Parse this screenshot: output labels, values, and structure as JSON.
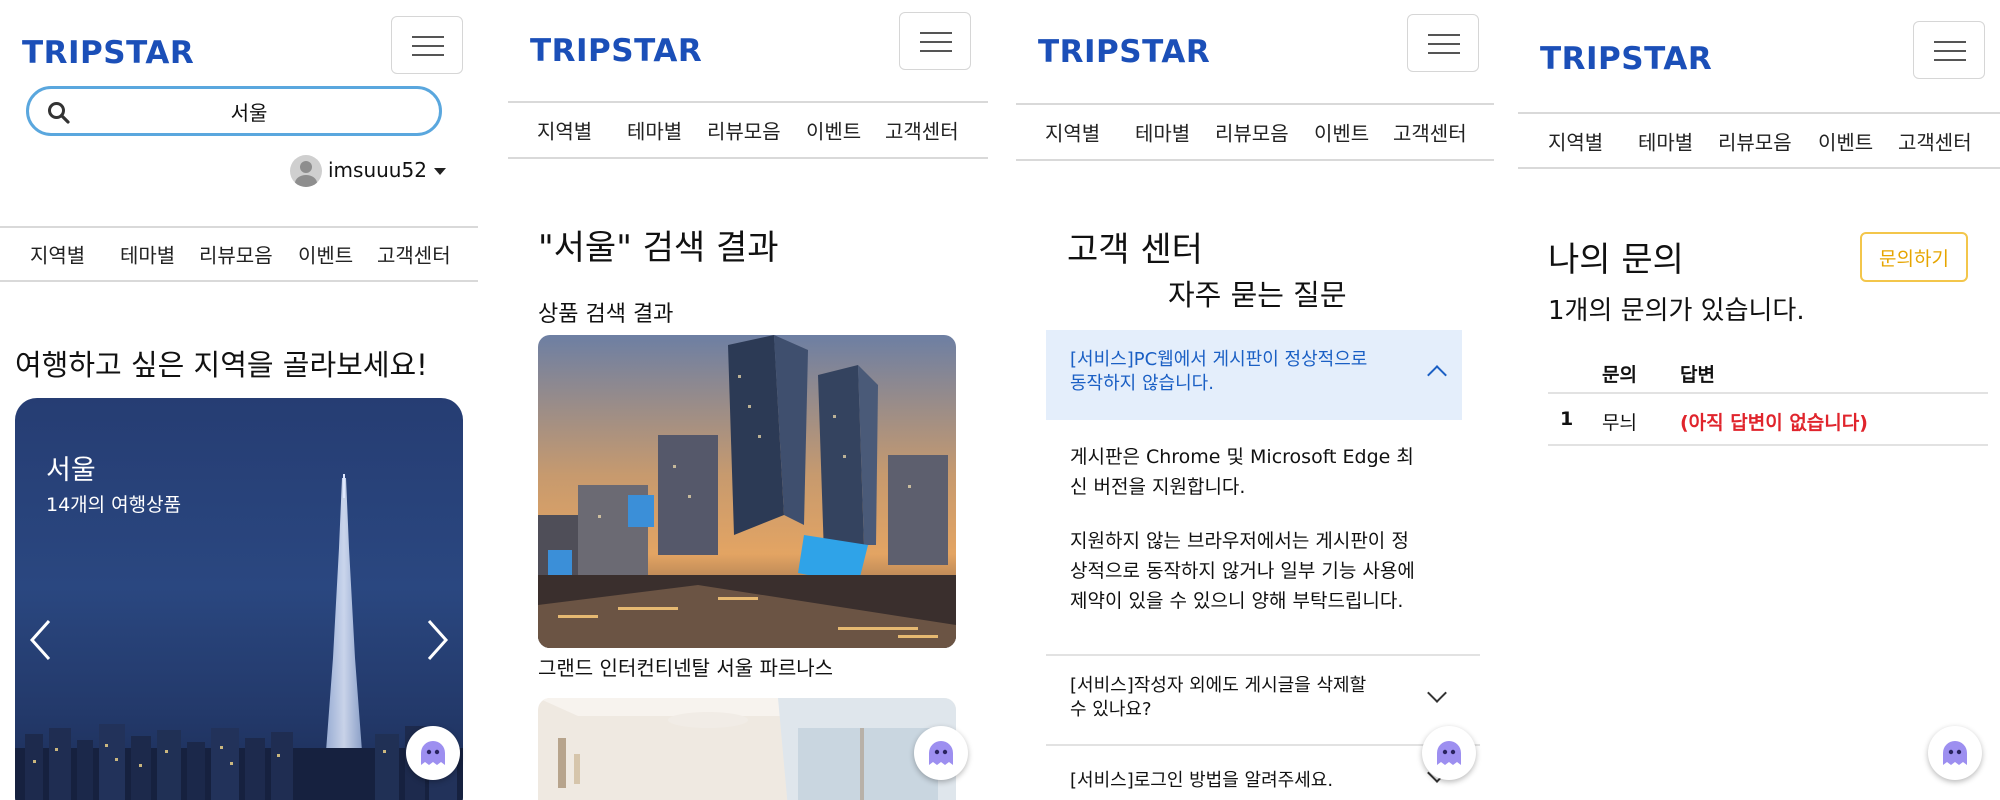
{
  "brand": {
    "logo_text": "TRIPSTAR",
    "color": "#1b4fb8"
  },
  "nav": {
    "items": [
      "지역별",
      "테마별",
      "리뷰모음",
      "이벤트",
      "고객센터"
    ]
  },
  "screen1": {
    "search": {
      "value": "서울"
    },
    "user": {
      "name": "imsuuu52"
    },
    "heading": "여행하고 싶은 지역을 골라보세요!",
    "hero": {
      "title": "서울",
      "subtitle": "14개의 여행상품"
    }
  },
  "screen2": {
    "heading": "\"서울\" 검색 결과",
    "section_title": "상품 검색 결과",
    "results": [
      {
        "name": "그랜드 인터컨티넨탈 서울 파르나스"
      }
    ]
  },
  "screen3": {
    "heading": "고객 센터",
    "faq_title": "자주 묻는 질문",
    "open_question_line1": "[서비스]PC웹에서 게시판이 정상적으로",
    "open_question_line2": "동작하지 않습니다.",
    "answer_p1_line1": "게시판은 Chrome 및 Microsoft Edge 최",
    "answer_p1_line2": "신 버전을 지원합니다.",
    "answer_p2_line1": "지원하지 않는 브라우저에서는 게시판이 정",
    "answer_p2_line2": "상적으로 동작하지 않거나 일부 기능 사용에",
    "answer_p2_line3": "제약이 있을 수 있으니 양해 부탁드립니다.",
    "q2_line1": "[서비스]작성자 외에도 게시글을 삭제할",
    "q2_line2": "수 있나요?",
    "q3_line1": "[서비스]로그인 방법을 알려주세요."
  },
  "screen4": {
    "heading": "나의 문의",
    "inquire_button": "문의하기",
    "count_text": "1개의 문의가 있습니다.",
    "table": {
      "headers": [
        "문의",
        "답변"
      ],
      "rows": [
        {
          "num": "1",
          "inquiry": "무늬",
          "answer": "(아직 답변이 없습니다)"
        }
      ]
    }
  },
  "colors": {
    "accent_blue": "#1b4fb8",
    "search_border": "#5aa7de",
    "faq_highlight": "#e4eefb",
    "faq_link": "#1a5fc4",
    "warning_red": "#e0242c",
    "inquire_yellow": "#f3c64b"
  },
  "icons": {
    "search": "search-icon",
    "menu": "hamburger-menu-icon",
    "chat": "chatbot-ghost-icon",
    "chevron_up": "chevron-up-icon",
    "chevron_down": "chevron-down-icon",
    "arrow_left": "arrow-left-icon",
    "arrow_right": "arrow-right-icon"
  }
}
